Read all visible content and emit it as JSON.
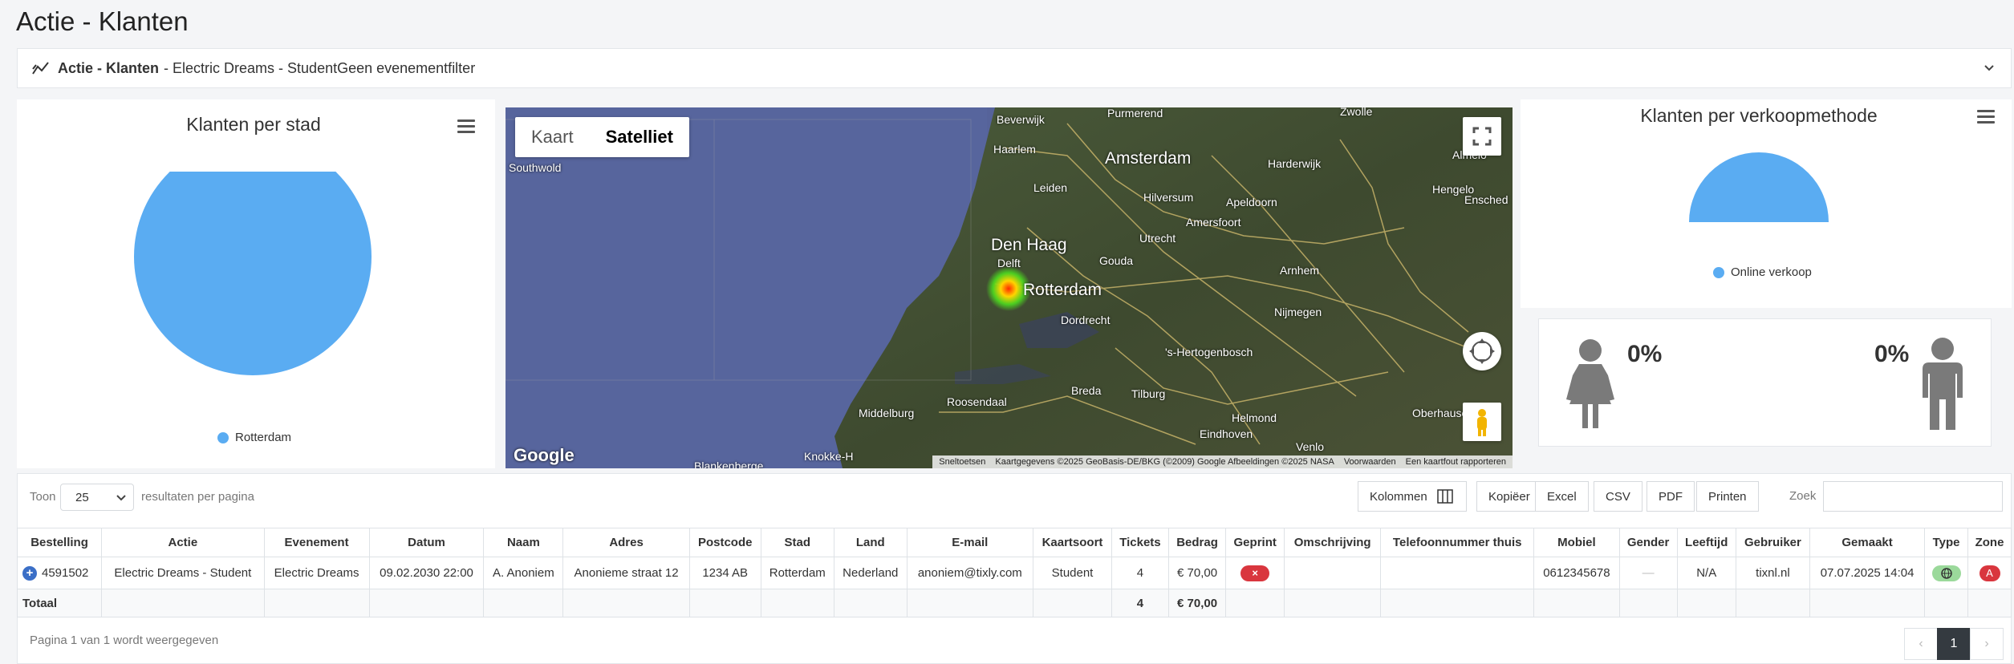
{
  "page": {
    "title": "Actie - Klanten"
  },
  "filter": {
    "title_bold": "Actie - Klanten",
    "title_rest": " - Electric Dreams - StudentGeen evenementfilter",
    "icon": "trend-line-icon",
    "toggle_icon": "chevron-down-icon"
  },
  "city_chart": {
    "menu_icon": "hamburger-menu-icon"
  },
  "map": {
    "tab_kaart": "Kaart",
    "tab_satelliet": "Satelliet",
    "active_tab": "Satelliet",
    "google": "Google",
    "attribution": {
      "shortcuts": "Sneltoetsen",
      "data": "Kaartgegevens ©2025 GeoBasis-DE/BKG (©2009) Google Afbeeldingen ©2025 NASA",
      "terms": "Voorwaarden",
      "report": "Een kaartfout rapporteren"
    },
    "cities": {
      "purmerend": "Purmerend",
      "zwolle": "Zwolle",
      "beverwijk": "Beverwijk",
      "haarlem": "Haarlem",
      "amsterdam": "Amsterdam",
      "almelo": "Almelo",
      "southwold": "Southwold",
      "harderwijk": "Harderwijk",
      "hengelo": "Hengelo",
      "enschede": "Ensched",
      "hilversum": "Hilversum",
      "leiden": "Leiden",
      "apeldoorn": "Apeldoorn",
      "amersfoort": "Amersfoort",
      "denhaag": "Den Haag",
      "utrecht": "Utrecht",
      "delft": "Delft",
      "gouda": "Gouda",
      "arnhem": "Arnhem",
      "rotterdam": "Rotterdam",
      "dordrecht": "Dordrecht",
      "nijmegen": "Nijmegen",
      "shertogenbosch": "'s-Hertogenbosch",
      "breda": "Breda",
      "tilburg": "Tilburg",
      "roosendaal": "Roosendaal",
      "middelburg": "Middelburg",
      "helmond": "Helmond",
      "oberhausen": "Oberhausen",
      "eindhoven": "Eindhoven",
      "knokke": "Knokke-H",
      "blankenberge": "Blankenberge",
      "venlo": "Venlo"
    }
  },
  "method_chart": {
    "title": "Klanten per verkoopmethode",
    "menu_icon": "hamburger-menu-icon"
  },
  "chart_data": [
    {
      "type": "pie",
      "title": "Klanten per stad",
      "categories": [
        "Rotterdam"
      ],
      "values": [
        100
      ],
      "legend": "bottom",
      "colors": [
        "#5aacf2"
      ]
    },
    {
      "type": "pie",
      "title": "Klanten per verkoopmethode",
      "categories": [
        "Online verkoop"
      ],
      "values": [
        100
      ],
      "style": "semi-circle",
      "legend": "bottom",
      "colors": [
        "#5aacf2"
      ]
    }
  ],
  "gender": {
    "female_pct": "0%",
    "male_pct": "0%",
    "female_icon": "female-person-icon",
    "male_icon": "male-person-icon"
  },
  "table_controls": {
    "show": "Toon",
    "page_size": "25",
    "per_page": "resultaten per pagina",
    "columns": "Kolommen",
    "copy": "Kopiëer",
    "excel": "Excel",
    "csv": "CSV",
    "pdf": "PDF",
    "print": "Printen",
    "search_label": "Zoek",
    "search_value": ""
  },
  "table": {
    "headers": [
      "Bestelling",
      "Actie",
      "Evenement",
      "Datum",
      "Naam",
      "Adres",
      "Postcode",
      "Stad",
      "Land",
      "E-mail",
      "Kaartsoort",
      "Tickets",
      "Bedrag",
      "Geprint",
      "Omschrijving",
      "Telefoonnummer thuis",
      "Mobiel",
      "Gender",
      "Leeftijd",
      "Gebruiker",
      "Gemaakt",
      "Type",
      "Zone"
    ],
    "row": {
      "bestelling": "4591502",
      "actie": "Electric Dreams - Student",
      "evenement": "Electric Dreams",
      "datum": "09.02.2030 22:00",
      "naam": "A. Anoniem",
      "adres": "Anonieme straat 12",
      "postcode": "1234 AB",
      "stad": "Rotterdam",
      "land": "Nederland",
      "email": "anoniem@tixly.com",
      "kaartsoort": "Student",
      "tickets": "4",
      "bedrag": "€ 70,00",
      "geprint": "×",
      "omschrijving": "",
      "telefoon": "",
      "mobiel": "0612345678",
      "gender": "—",
      "leeftijd": "N/A",
      "gebruiker": "tixnl.nl",
      "gemaakt": "07.07.2025 14:04",
      "type_icon": "globe-icon",
      "zone": "A"
    },
    "total": {
      "label": "Totaal",
      "tickets": "4",
      "bedrag": "€ 70,00"
    }
  },
  "footer": {
    "info": "Pagina 1 van 1 wordt weergegeven",
    "page": "1",
    "prev": "‹",
    "next": "›"
  },
  "colors": {
    "accent": "#5aacf2",
    "badge_red": "#d9363e",
    "badge_green": "#9bd99b",
    "pager_active": "#343a40"
  }
}
